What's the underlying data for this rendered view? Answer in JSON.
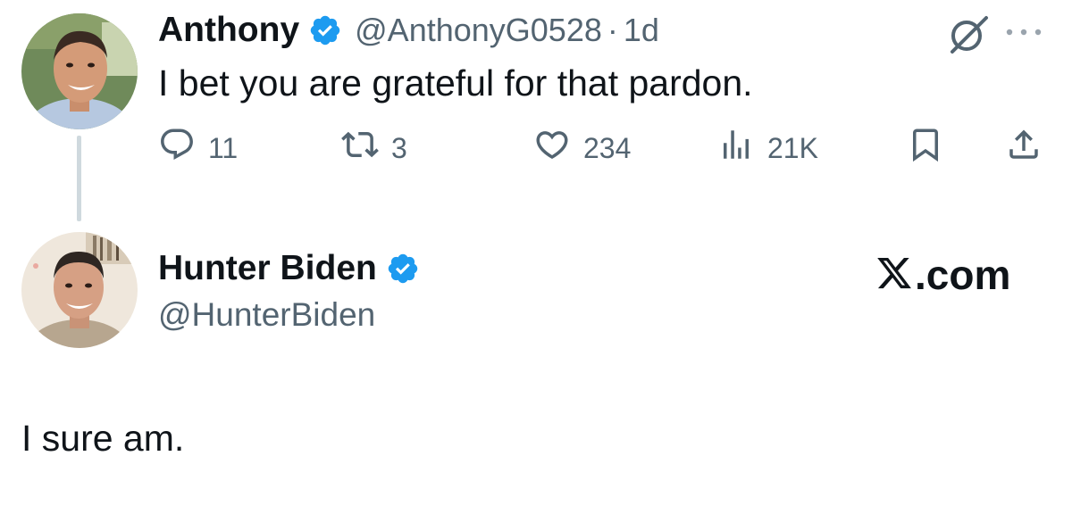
{
  "tweet1": {
    "author_name": "Anthony",
    "handle": "@AnthonyG0528",
    "separator": "·",
    "time": "1d",
    "text": "I bet you are grateful for that pardon.",
    "metrics": {
      "replies": "11",
      "reposts": "3",
      "likes": "234",
      "views": "21K"
    }
  },
  "tweet2": {
    "author_name": "Hunter Biden",
    "handle": "@HunterBiden",
    "text": "I sure am.",
    "brand_text": ".com"
  },
  "colors": {
    "verified_blue": "#1d9bf0",
    "text_primary": "#0f1419",
    "text_secondary": "#536471",
    "thread_line": "#cfd9de"
  },
  "icons": [
    "verified-badge-icon",
    "grok-icon",
    "more-icon",
    "reply-icon",
    "repost-icon",
    "like-icon",
    "views-icon",
    "bookmark-icon",
    "share-icon",
    "x-logo-icon"
  ]
}
